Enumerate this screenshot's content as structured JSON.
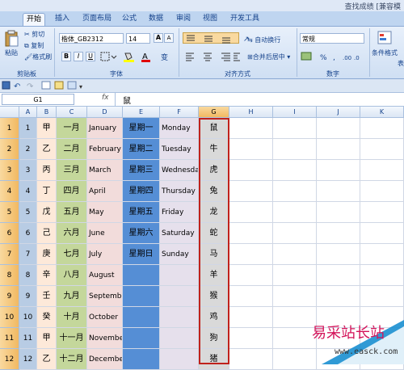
{
  "title_bar": {
    "right_text": "查找成绩 [兼容模"
  },
  "tabs": [
    {
      "label": "开始",
      "active": true
    },
    {
      "label": "插入",
      "active": false
    },
    {
      "label": "页面布局",
      "active": false
    },
    {
      "label": "公式",
      "active": false
    },
    {
      "label": "数据",
      "active": false
    },
    {
      "label": "审阅",
      "active": false
    },
    {
      "label": "视图",
      "active": false
    },
    {
      "label": "开发工具",
      "active": false
    }
  ],
  "ribbon": {
    "clipboard": {
      "paste": "粘贴",
      "cut": "剪切",
      "copy": "复制",
      "format_painter": "格式刷",
      "label": "剪贴板"
    },
    "font": {
      "name": "楷体_GB2312",
      "size": "14",
      "grow": "A",
      "shrink": "A",
      "bold": "B",
      "italic": "I",
      "underline": "U",
      "label": "字体"
    },
    "alignment": {
      "wrap": "自动换行",
      "merge": "合并后居中",
      "label": "对齐方式"
    },
    "number": {
      "format": "常规",
      "percent": "%",
      "comma": ",",
      "label": "数字"
    },
    "styles": {
      "conditional": "条件格式",
      "more": "表"
    }
  },
  "formula_bar": {
    "name_box": "G1",
    "fx": "fx",
    "content": "鼠"
  },
  "columns": [
    "A",
    "B",
    "C",
    "D",
    "E",
    "F",
    "G",
    "H",
    "I",
    "J",
    "K"
  ],
  "selected_column": "G",
  "rows": [
    [
      "1",
      "甲",
      "一月",
      "January",
      "星期一",
      "Monday",
      "鼠"
    ],
    [
      "2",
      "乙",
      "二月",
      "February",
      "星期二",
      "Tuesday",
      "牛"
    ],
    [
      "3",
      "丙",
      "三月",
      "March",
      "星期三",
      "Wednesday",
      "虎"
    ],
    [
      "4",
      "丁",
      "四月",
      "April",
      "星期四",
      "Thursday",
      "兔"
    ],
    [
      "5",
      "戊",
      "五月",
      "May",
      "星期五",
      "Friday",
      "龙"
    ],
    [
      "6",
      "己",
      "六月",
      "June",
      "星期六",
      "Saturday",
      "蛇"
    ],
    [
      "7",
      "庚",
      "七月",
      "July",
      "星期日",
      "Sunday",
      "马"
    ],
    [
      "8",
      "辛",
      "八月",
      "August",
      "",
      "",
      "羊"
    ],
    [
      "9",
      "壬",
      "九月",
      "September",
      "",
      "",
      "猴"
    ],
    [
      "10",
      "癸",
      "十月",
      "October",
      "",
      "",
      "鸡"
    ],
    [
      "11",
      "甲",
      "十一月",
      "November",
      "",
      "",
      "狗"
    ],
    [
      "12",
      "乙",
      "十二月",
      "December",
      "",
      "",
      "猪"
    ]
  ],
  "row_headers": [
    "1",
    "2",
    "3",
    "4",
    "5",
    "6",
    "7",
    "8",
    "9",
    "10",
    "11",
    "12"
  ],
  "colors": {
    "colA": "#b8cce4",
    "colB": "#fde9d9",
    "colC": "#c4d79b",
    "colD": "#f2dcdb",
    "colE": "#558ed5",
    "colF": "#e6e0ec",
    "colG": "#d9d9d9",
    "selection": "#c0221c"
  },
  "watermark": {
    "brand": "易采站长站",
    "url": "www.easck.com"
  }
}
